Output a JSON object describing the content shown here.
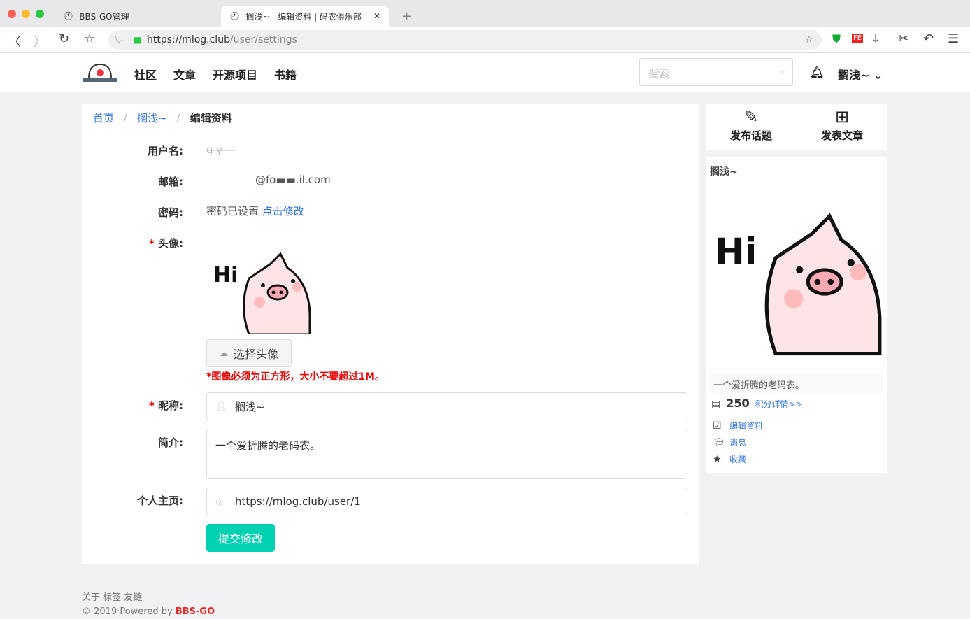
{
  "browser": {
    "tabs": [
      {
        "title": "BBS-GO管理"
      },
      {
        "title": "搁浅~ - 编辑资料 | 码农俱乐部 -"
      }
    ],
    "url_host": "https://mlog.club",
    "url_path": "/user/settings"
  },
  "header": {
    "menu": [
      "社区",
      "文章",
      "开源项目",
      "书籍"
    ],
    "search_placeholder": "搜索",
    "user": "搁浅~"
  },
  "breadcrumb": {
    "home": "首页",
    "user": "搁浅~",
    "current": "编辑资料",
    "sep": "/"
  },
  "form": {
    "username_label": "用户名:",
    "username": "g̶ ̶y̶ ̶ ̶ ̶ ̶",
    "email_label": "邮箱:",
    "email": "@fo▬▬.il.com",
    "password_label": "密码:",
    "password_status": "密码已设置",
    "password_link": "点击修改",
    "avatar_label": "头像:",
    "avatar_button": "选择头像",
    "avatar_hint": "*图像必须为正方形，大小不要超过1M。",
    "nickname_label": "昵称:",
    "nickname": "搁浅~",
    "intro_label": "简介:",
    "intro": "一个爱折腾的老码农。",
    "homepage_label": "个人主页:",
    "homepage": "https://mlog.club/user/1",
    "submit": "提交修改",
    "required_mark": "*"
  },
  "sidebar": {
    "actions": [
      "发布话题",
      "发表文章"
    ],
    "username": "搁浅~",
    "bio": "一个爱折腾的老码农。",
    "score": "250",
    "score_link": "积分详情>>",
    "links": [
      "编辑资料",
      "消息",
      "收藏"
    ]
  },
  "footer": {
    "links": "关于 标签 友链",
    "copyright": "© 2019 Powered by ",
    "brand": "BBS-GO"
  }
}
